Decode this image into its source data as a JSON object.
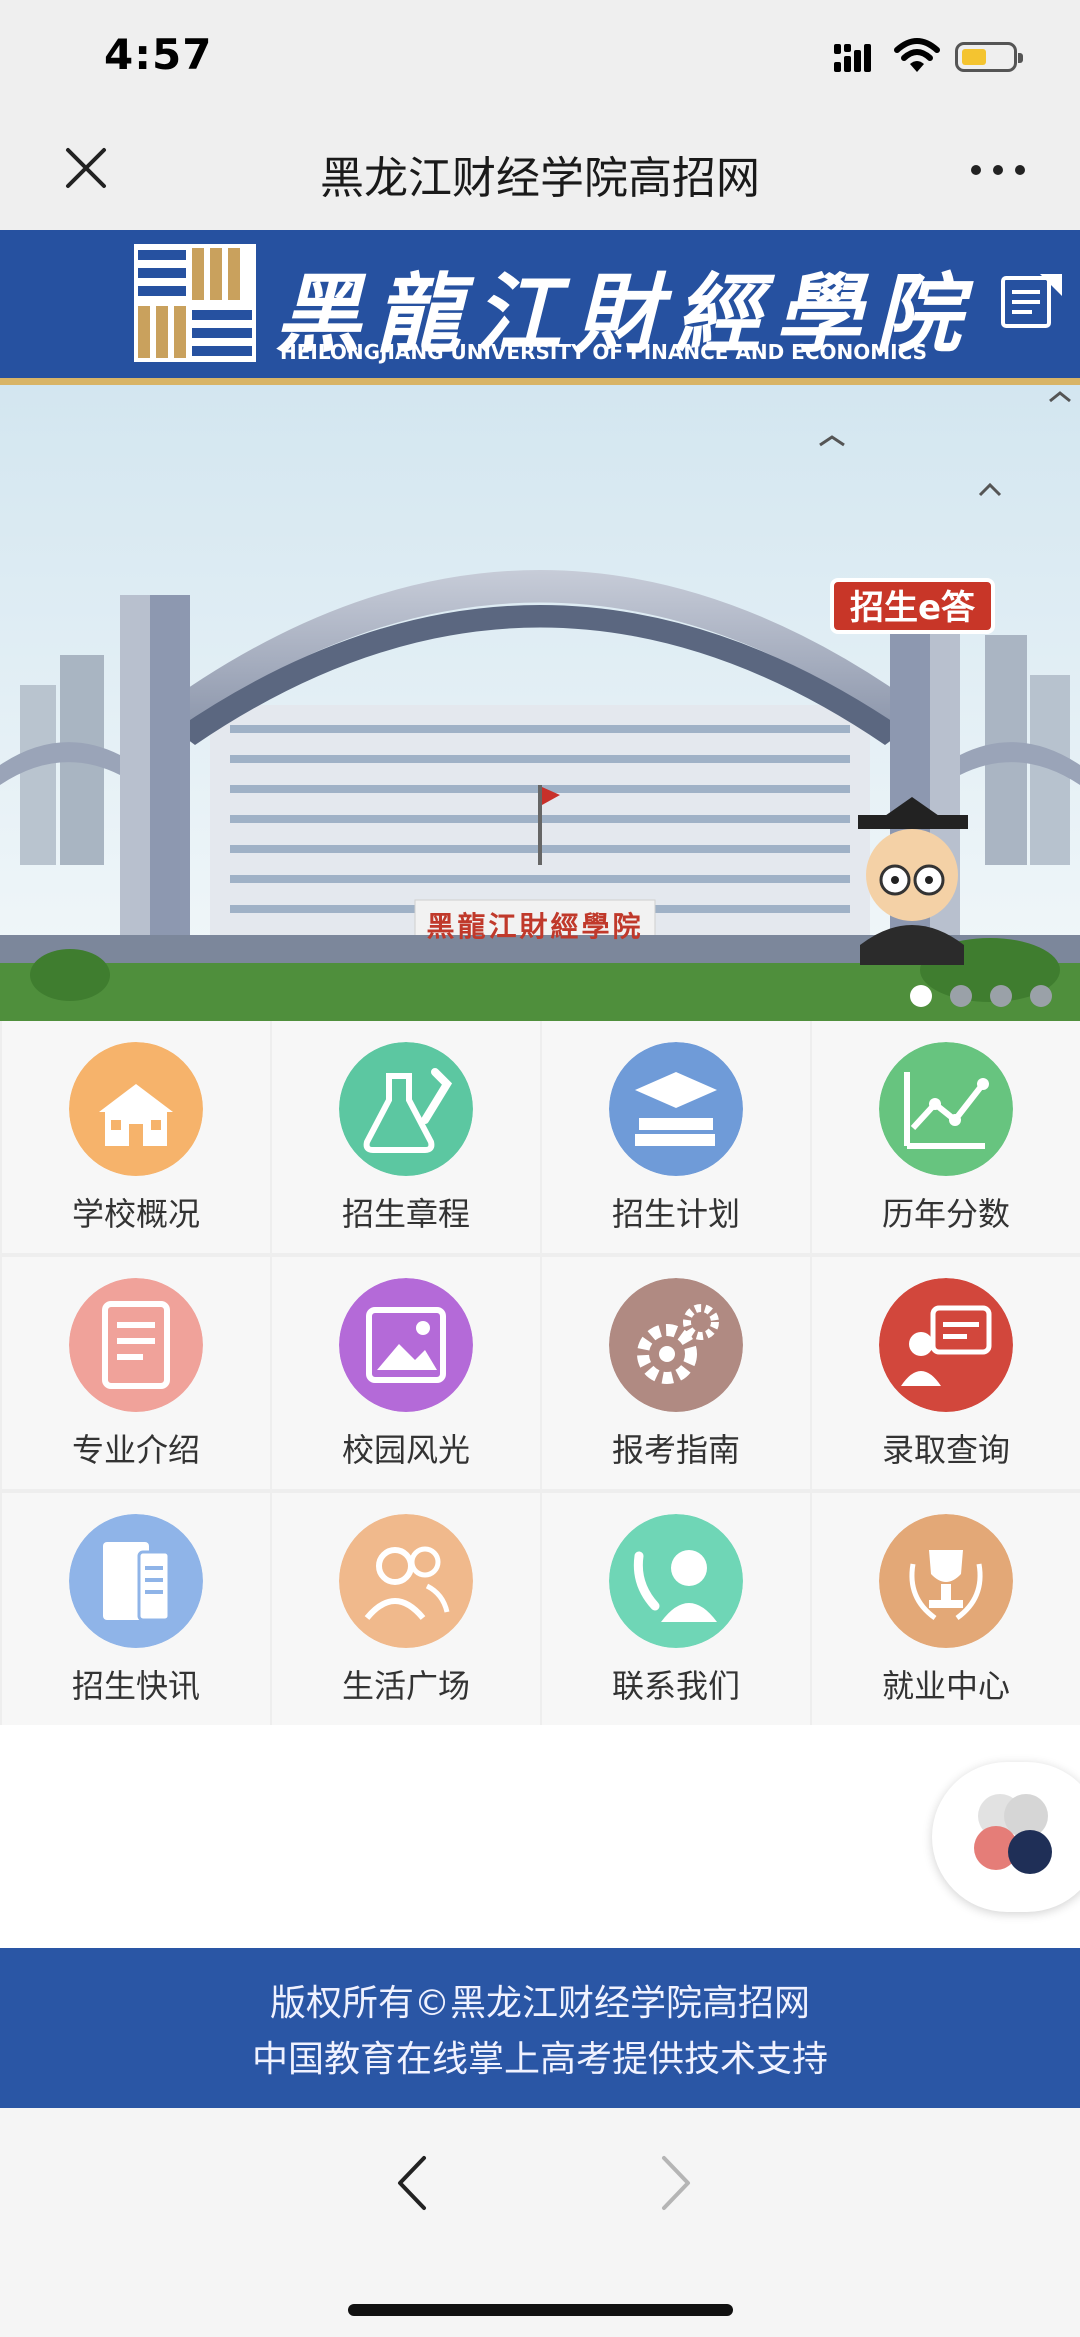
{
  "status_bar": {
    "time": "4:57"
  },
  "nav": {
    "title": "黑龙江财经学院高招网"
  },
  "banner": {
    "name_cn": "黑龍江財經學院",
    "name_en": "HEILONGJIANG UNIVERSITY OF FINANCE AND ECONOMICS"
  },
  "hero": {
    "mascot_label": "招生e答",
    "gate_sign": "黑龍江財經學院",
    "slide_count": 4,
    "active_slide": 1
  },
  "menu": [
    {
      "label": "学校概况",
      "icon": "school-building-icon",
      "color": "#f6b36b"
    },
    {
      "label": "招生章程",
      "icon": "lab-flask-icon",
      "color": "#5cc7a1"
    },
    {
      "label": "招生计划",
      "icon": "graduation-cap-books-icon",
      "color": "#6f9bd8"
    },
    {
      "label": "历年分数",
      "icon": "line-chart-icon",
      "color": "#67c47f"
    },
    {
      "label": "专业介绍",
      "icon": "document-icon",
      "color": "#f0a29a"
    },
    {
      "label": "校园风光",
      "icon": "picture-frame-icon",
      "color": "#b46ad8"
    },
    {
      "label": "报考指南",
      "icon": "gears-icon",
      "color": "#b08a82"
    },
    {
      "label": "录取查询",
      "icon": "presentation-icon",
      "color": "#d2473c"
    },
    {
      "label": "招生快讯",
      "icon": "newsletter-icon",
      "color": "#8fb4e8"
    },
    {
      "label": "生活广场",
      "icon": "people-icon",
      "color": "#f0b98c"
    },
    {
      "label": "联系我们",
      "icon": "contact-phone-icon",
      "color": "#6fd6b6"
    },
    {
      "label": "就业中心",
      "icon": "trophy-icon",
      "color": "#e3a877"
    }
  ],
  "footer": {
    "line1": "版权所有©黑龙江财经学院高招网",
    "line2": "中国教育在线掌上高考提供技术支持"
  }
}
